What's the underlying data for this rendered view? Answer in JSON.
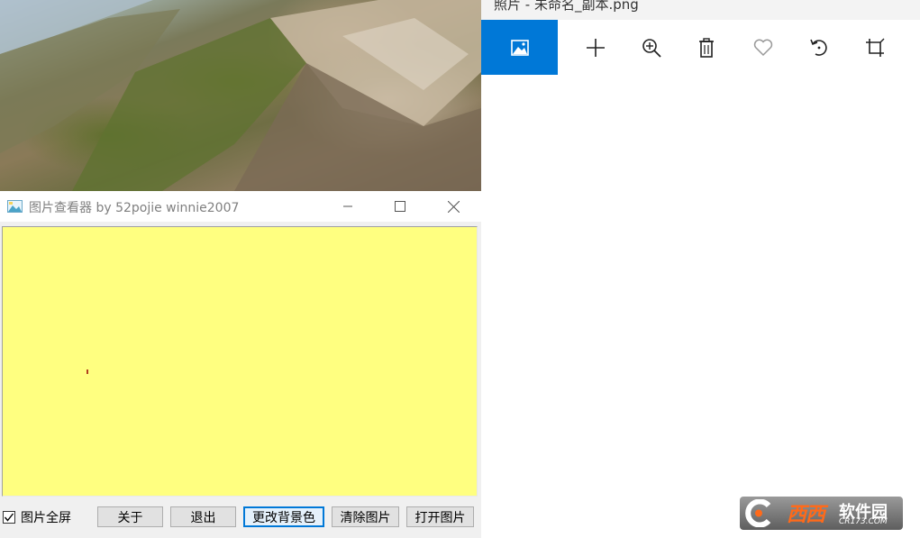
{
  "viewer": {
    "title": "图片查看器  by 52pojie winnie2007",
    "canvas_color": "#ffff80",
    "fullscreen_label": "图片全屏",
    "fullscreen_checked": true,
    "buttons": {
      "about": "关于",
      "exit": "退出",
      "change_bg": "更改背景色",
      "clear": "清除图片",
      "open": "打开图片"
    }
  },
  "photos": {
    "title": "照片 - 未命名_副本.png",
    "accent": "#0078d7",
    "commands": [
      "image-icon",
      "add-icon",
      "zoom-in-icon",
      "delete-icon",
      "favorite-icon",
      "rotate-icon",
      "crop-icon"
    ]
  },
  "logo": {
    "brand": "西西",
    "brand2": "软件园",
    "site": "CR173.COM"
  }
}
